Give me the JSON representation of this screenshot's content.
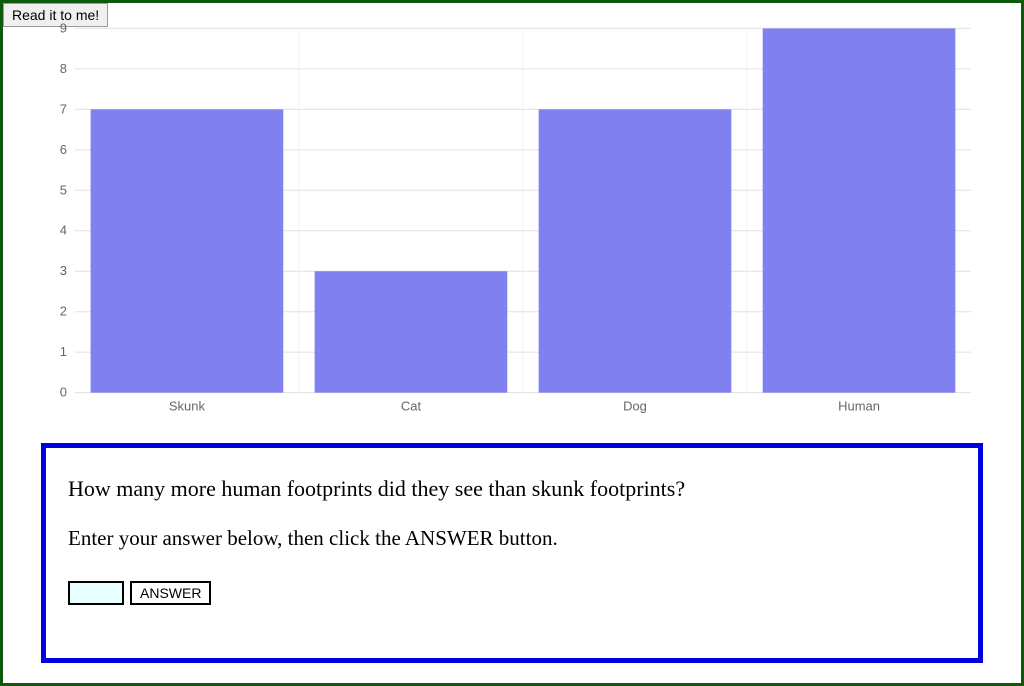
{
  "read_button_label": "Read it to me!",
  "chart_data": {
    "type": "bar",
    "categories": [
      "Skunk",
      "Cat",
      "Dog",
      "Human"
    ],
    "values": [
      7,
      3,
      7,
      9
    ],
    "ylim": [
      0,
      9
    ],
    "yticks": [
      0,
      1,
      2,
      3,
      4,
      5,
      6,
      7,
      8,
      9
    ],
    "bar_color": "#8080f0"
  },
  "question": {
    "prompt": "How many more human footprints did they see than skunk footprints?",
    "instruction": "Enter your answer below, then click the ANSWER button.",
    "answer_value": "",
    "answer_button_label": "ANSWER"
  },
  "frame_colors": {
    "outer_border": "#0d5a0d",
    "question_border": "#0000e0",
    "input_bg": "#e6ffff"
  }
}
